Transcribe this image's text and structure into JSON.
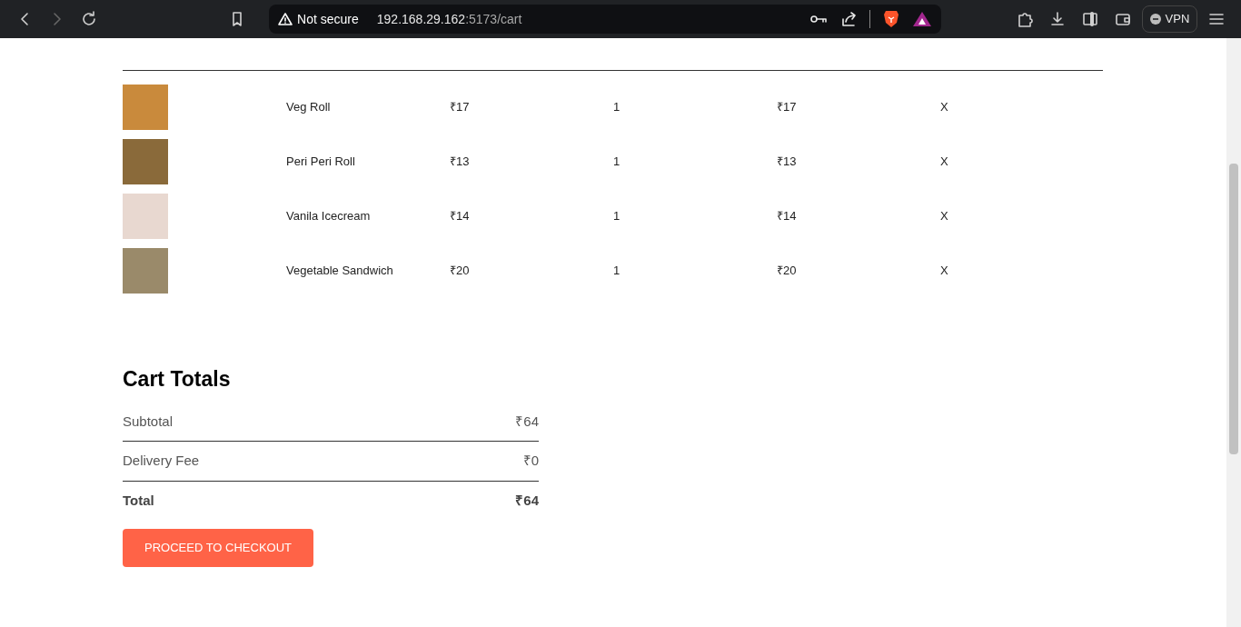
{
  "browser": {
    "forward_disabled": true,
    "security_label": "Not secure",
    "url_host": "192.168.29.162",
    "url_rest": ":5173/cart",
    "vpn_label": "VPN"
  },
  "cart_items": [
    {
      "title": "Veg Roll",
      "price": "₹17",
      "quantity": "1",
      "total": "₹17",
      "remove": "X"
    },
    {
      "title": "Peri Peri Roll",
      "price": "₹13",
      "quantity": "1",
      "total": "₹13",
      "remove": "X"
    },
    {
      "title": "Vanila Icecream",
      "price": "₹14",
      "quantity": "1",
      "total": "₹14",
      "remove": "X"
    },
    {
      "title": "Vegetable Sandwich",
      "price": "₹20",
      "quantity": "1",
      "total": "₹20",
      "remove": "X"
    }
  ],
  "cart_totals": {
    "title": "Cart Totals",
    "rows": [
      {
        "kind": "plain",
        "label": "Subtotal",
        "value": "₹64"
      },
      {
        "kind": "plain",
        "label": "Delivery Fee",
        "value": "₹0"
      },
      {
        "kind": "grand",
        "label": "Total",
        "value": "₹64"
      }
    ],
    "checkout_button": "PROCEED TO CHECKOUT"
  }
}
